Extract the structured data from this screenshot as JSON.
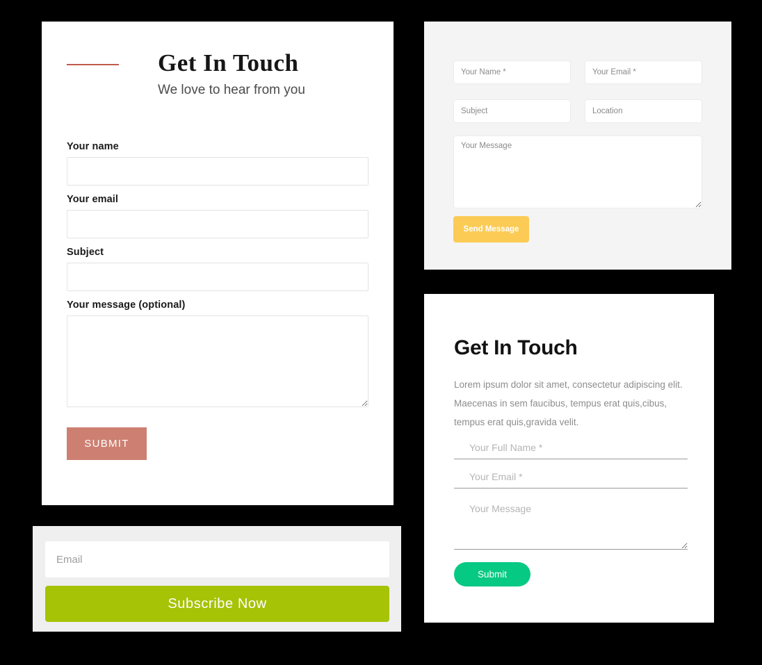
{
  "contact_form": {
    "eyebrow_rule_color": "#c05a4b",
    "title": "Get In Touch",
    "subtitle": "We love to hear from you",
    "fields": [
      {
        "label": "Your name",
        "value": "",
        "placeholder": ""
      },
      {
        "label": "Your email",
        "value": "",
        "placeholder": ""
      },
      {
        "label": "Subject",
        "value": "",
        "placeholder": ""
      }
    ],
    "message": {
      "label": "Your message (optional)",
      "value": "",
      "placeholder": ""
    },
    "submit_label": "SUBMIT",
    "submit_color": "#cd8072"
  },
  "subscribe": {
    "email_placeholder": "Email",
    "email_value": "",
    "button_label": "Subscribe Now",
    "button_color": "#a6c306",
    "panel_color": "#efefef"
  },
  "send_message": {
    "panel_color": "#f4f4f4",
    "name_placeholder": "Your Name *",
    "name_value": "",
    "email_placeholder": "Your Email *",
    "email_value": "",
    "subject_placeholder": "Subject",
    "subject_value": "",
    "location_placeholder": "Location",
    "location_value": "",
    "message_placeholder": "Your Message",
    "message_value": "",
    "button_label": "Send Message",
    "button_color": "#fbcb56"
  },
  "get_in_touch_minimal": {
    "title": "Get In Touch",
    "description": "Lorem ipsum dolor sit amet, consectetur adipiscing elit. Maecenas in sem faucibus, tempus erat quis,cibus, tempus erat quis,gravida velit.",
    "full_name_placeholder": "Your Full Name *",
    "full_name_value": "",
    "email_placeholder": "Your Email *",
    "email_value": "",
    "message_placeholder": "Your Message",
    "message_value": "",
    "button_label": "Submit",
    "button_color": "#06c983"
  }
}
